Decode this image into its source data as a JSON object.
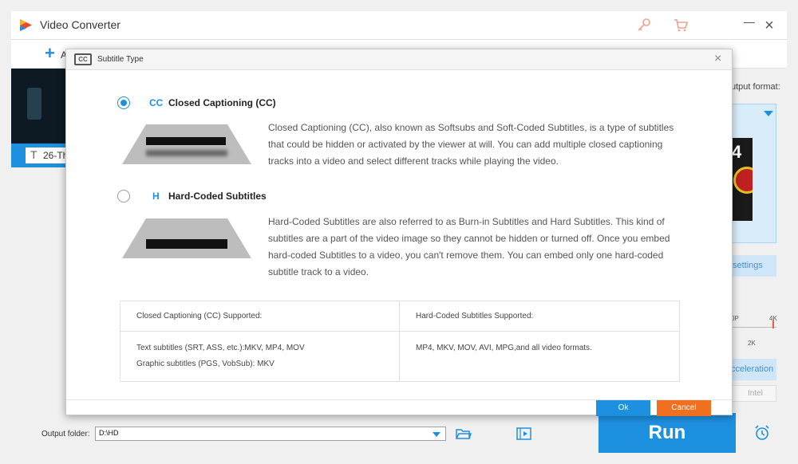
{
  "app": {
    "title": "Video Converter",
    "add_label": "A"
  },
  "file_list": {
    "subtitle_name": "26-Th"
  },
  "right_panel": {
    "output_format_label": "utput format:",
    "format_number": "4",
    "settings_label": "settings",
    "res_low": "0P",
    "res_high": "4K",
    "res_mid": "2K",
    "acceleration_label": "cceleration",
    "intel_label": "Intel"
  },
  "bottom": {
    "output_folder_label": "Output folder:",
    "output_folder_value": "D:\\HD",
    "run_label": "Run"
  },
  "dialog": {
    "title": "Subtitle Type",
    "header_icon_text": "CC",
    "options": [
      {
        "tag": "CC",
        "title": "Closed Captioning (CC)",
        "selected": true,
        "description": "Closed Captioning (CC), also known as Softsubs and Soft-Coded Subtitles, is a type of subtitles that could be hidden or activated by the viewer at will. You can add multiple closed captioning tracks into a video and select different tracks while playing the video."
      },
      {
        "tag": "H",
        "title": "Hard-Coded Subtitles",
        "selected": false,
        "description": "Hard-Coded Subtitles are also referred to as Burn-in Subtitles and Hard Subtitles. This kind of subtitles are a part of the video image so they cannot be hidden or turned off. Once you embed hard-coded Subtitles to a video, you can't remove them. You can embed only one hard-coded subtitle track to a video."
      }
    ],
    "table": {
      "headers": [
        "Closed Captioning (CC) Supported:",
        "Hard-Coded Subtitles Supported:"
      ],
      "cc_lines": [
        "Text subtitles (SRT, ASS, etc.):MKV, MP4, MOV",
        "Graphic subtitles (PGS, VobSub): MKV"
      ],
      "hc_lines": [
        "MP4, MKV, MOV, AVI, MPG,and all video formats."
      ]
    },
    "ok_label": "Ok",
    "cancel_label": "Cancel"
  },
  "colors": {
    "accent": "#1e90e0",
    "cancel": "#f07020",
    "run": "#1e90e0"
  },
  "icons": [
    "app-logo-icon",
    "key-icon",
    "cart-icon",
    "minimize-icon",
    "close-icon",
    "plus-icon",
    "text-icon",
    "dropdown-arrow-icon",
    "folder-icon",
    "video-folder-icon",
    "alarm-clock-icon",
    "cc-icon"
  ]
}
